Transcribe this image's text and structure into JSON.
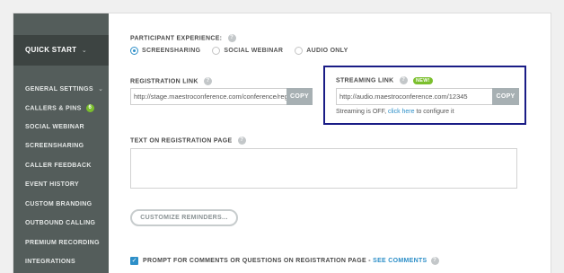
{
  "sidebar": {
    "quick_start": "QUICK START",
    "items": [
      {
        "label": "GENERAL SETTINGS",
        "has_chevron": true
      },
      {
        "label": "CALLERS & PINS",
        "badge": "6"
      },
      {
        "label": "SOCIAL WEBINAR"
      },
      {
        "label": "SCREENSHARING"
      },
      {
        "label": "CALLER FEEDBACK"
      },
      {
        "label": "EVENT HISTORY"
      },
      {
        "label": "CUSTOM BRANDING"
      },
      {
        "label": "OUTBOUND CALLING"
      },
      {
        "label": "PREMIUM RECORDING"
      },
      {
        "label": "INTEGRATIONS"
      }
    ]
  },
  "participant_experience": {
    "label": "PARTICIPANT EXPERIENCE:",
    "options": [
      {
        "label": "SCREENSHARING",
        "selected": true
      },
      {
        "label": "SOCIAL WEBINAR",
        "selected": false
      },
      {
        "label": "AUDIO ONLY",
        "selected": false
      }
    ]
  },
  "registration_link": {
    "label": "REGISTRATION LINK",
    "value": "http://stage.maestroconference.com/conference/register",
    "copy_label": "COPY"
  },
  "streaming_link": {
    "label": "STREAMING LINK",
    "new_badge": "NEW!",
    "value": "http://audio.maestroconference.com/12345",
    "copy_label": "COPY",
    "status_prefix": "Streaming is OFF,",
    "status_link": "click here",
    "status_suffix": "to configure it"
  },
  "registration_text": {
    "label": "TEXT ON REGISTRATION PAGE",
    "value": ""
  },
  "customize_reminders_label": "CUSTOMIZE REMINDERS...",
  "prompt": {
    "checked": true,
    "label": "PROMPT FOR COMMENTS OR QUESTIONS ON REGISTRATION PAGE",
    "separator": " - ",
    "link": "SEE COMMENTS"
  },
  "colors": {
    "sidebar": "#545d5b",
    "sidebar_active": "#3d4442",
    "accent_blue": "#2d8fc8",
    "badge_green": "#7bbf2d",
    "highlight_border": "#1a1c86"
  }
}
